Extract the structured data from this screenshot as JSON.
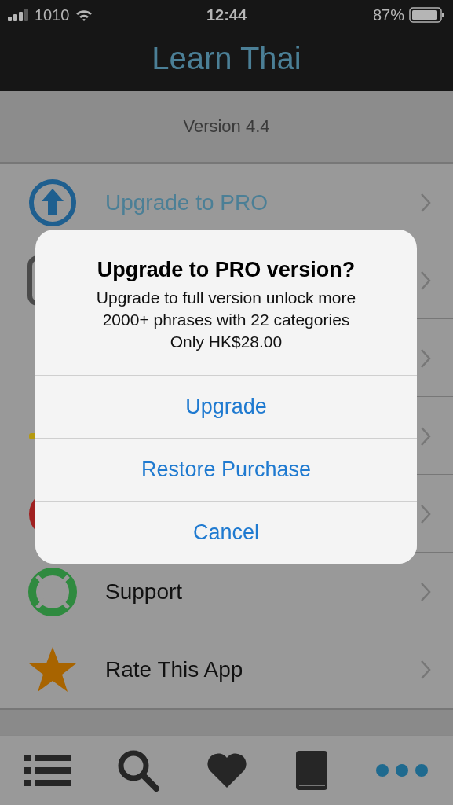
{
  "status_bar": {
    "carrier": "1010",
    "time": "12:44",
    "battery": "87%"
  },
  "header": {
    "title": "Learn Thai"
  },
  "version": "Version 4.4",
  "menu_rows": [
    {
      "kind": "upgrade",
      "label": "Upgrade to PRO"
    },
    {
      "kind": "square"
    },
    {
      "kind": "blank"
    },
    {
      "kind": "sun"
    },
    {
      "kind": "red-circle"
    },
    {
      "kind": "support",
      "label": "Support"
    },
    {
      "kind": "star",
      "label": "Rate This App"
    }
  ],
  "dialog": {
    "title": "Upgrade to PRO version?",
    "message": [
      "Upgrade to full version unlock more",
      "2000+ phrases with 22 categories",
      "Only HK$28.00"
    ],
    "buttons": [
      "Upgrade",
      "Restore Purchase",
      "Cancel"
    ]
  },
  "tab_bar": [
    {
      "kind": "list"
    },
    {
      "kind": "search"
    },
    {
      "kind": "heart"
    },
    {
      "kind": "book"
    },
    {
      "kind": "more"
    }
  ]
}
